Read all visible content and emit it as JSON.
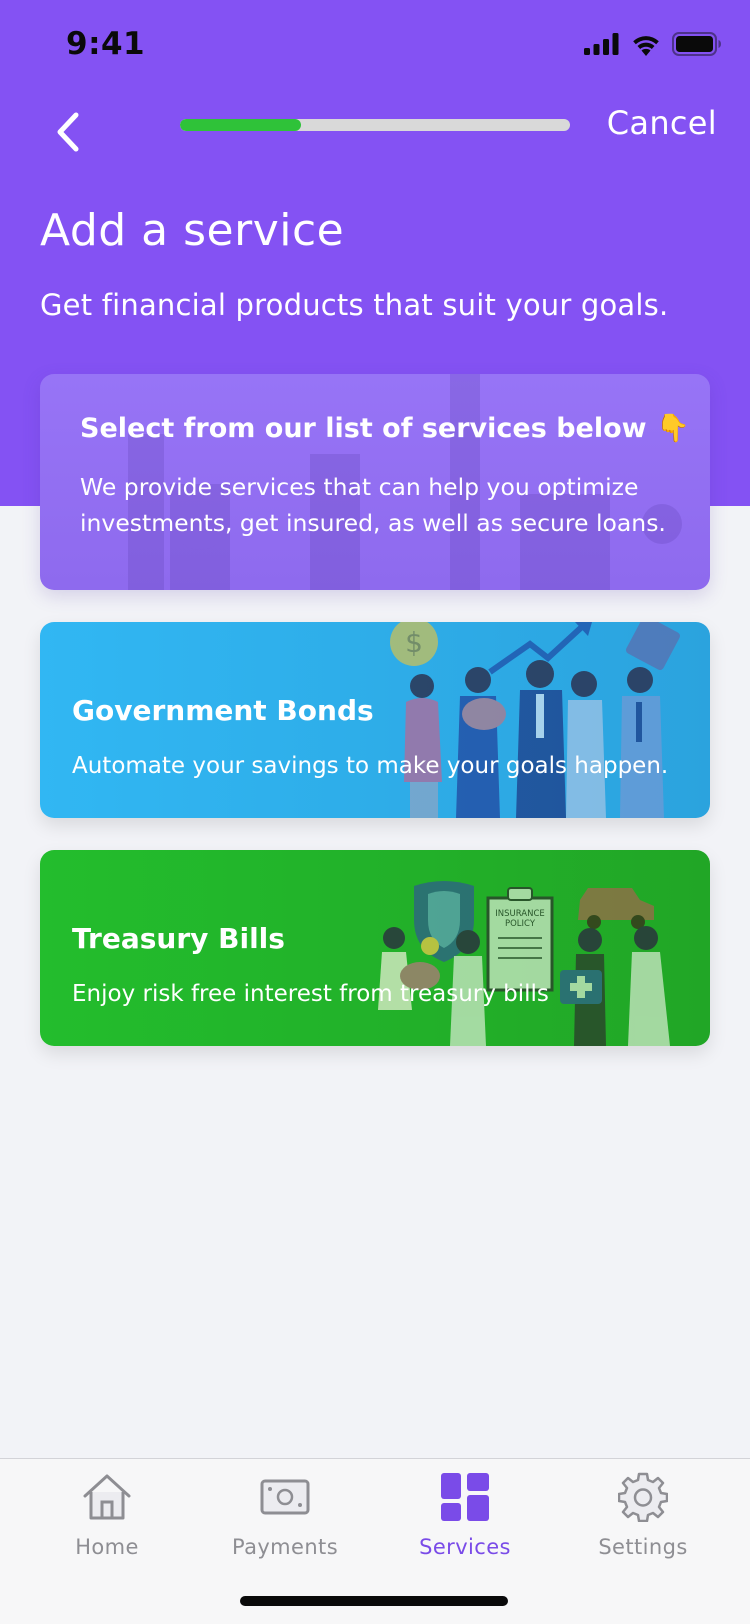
{
  "status_bar": {
    "time": "9:41"
  },
  "nav": {
    "cancel_label": "Cancel",
    "progress_fraction": 0.31
  },
  "header": {
    "title": "Add a service",
    "subtitle": "Get financial products that suit your goals."
  },
  "info_card": {
    "title": "Select from our list of services below 👇",
    "body": "We provide services that can help you optimize investments, get insured, as well as secure loans."
  },
  "services": [
    {
      "name": "Government Bonds",
      "description": "Automate your savings to make your goals happen."
    },
    {
      "name": "Treasury Bills",
      "description": "Enjoy risk free interest from treasury bills"
    }
  ],
  "tabbar": {
    "tabs": [
      {
        "label": "Home",
        "icon": "home-icon"
      },
      {
        "label": "Payments",
        "icon": "payments-icon"
      },
      {
        "label": "Services",
        "icon": "services-icon",
        "active": true
      },
      {
        "label": "Settings",
        "icon": "settings-icon"
      }
    ]
  },
  "colors": {
    "header_purple": "#8452F3",
    "bonds_blue": "#31B7F3",
    "bills_green": "#23BD2D",
    "progress_green": "#2FC239",
    "active_tab": "#7A4BE8"
  }
}
